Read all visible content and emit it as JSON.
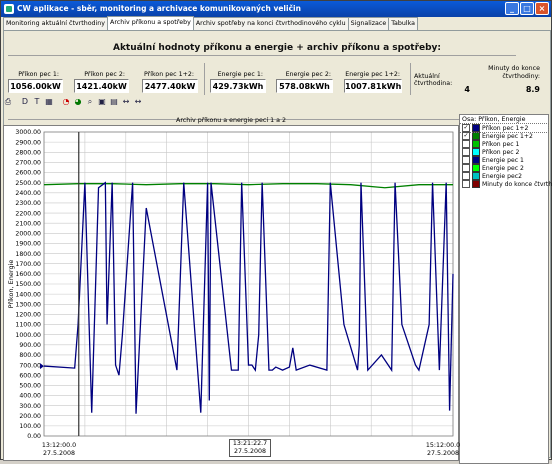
{
  "window": {
    "title": "CW aplikace  - sběr, monitoring a archivace komunikovaných veličin"
  },
  "tabs": [
    {
      "label": "Monitoring aktuální čtvrthodiny",
      "active": false
    },
    {
      "label": "Archiv příkonu a spotřeby",
      "active": true
    },
    {
      "label": "Archiv spotřeby na konci čtvrthodinového cyklu",
      "active": false
    },
    {
      "label": "Signalizace",
      "active": false
    },
    {
      "label": "Tabulka",
      "active": false
    }
  ],
  "heading": "Aktuální hodnoty příkonu a energie + archiv příkonu a spotřeby:",
  "readouts": {
    "prikon1": {
      "label": "Příkon pec 1:",
      "value": "1056.00kW"
    },
    "prikon2": {
      "label": "Příkon pec 2:",
      "value": "1421.40kW"
    },
    "prikon12": {
      "label": "Příkon pec 1+2:",
      "value": "2477.40kW"
    },
    "energie1": {
      "label": "Energie pec 1:",
      "value": "429.73kWh"
    },
    "energie2": {
      "label": "Energie pec 2:",
      "value": "578.08kWh"
    },
    "energie12": {
      "label": "Energie pec 1+2:",
      "value": "1007.81kWh"
    },
    "ctvrthodina": {
      "label": "Aktuální čtvrthodina:",
      "value": "4"
    },
    "minuty": {
      "label": "Minuty do konce čtvrthodiny:",
      "value": "8.9"
    }
  },
  "toolbar_icons": [
    "printer-icon",
    "axis-dt-icon",
    "axis-y-icon",
    "grid-icon",
    "zoom-in-icon",
    "zoom-out-icon",
    "zoom-icon",
    "pan-icon",
    "pan-back-icon",
    "arrows-h-icon",
    "arrows-h2-icon"
  ],
  "toolbar_text": {
    "d": "D",
    "t": "T",
    "arrows1": "↔",
    "arrows2": "↔"
  },
  "legend": {
    "title": "Osa: Příkon, Energie",
    "items": [
      {
        "label": "Příkon pec 1+2",
        "checked": true,
        "color": "#000080",
        "selected": true
      },
      {
        "label": "Energie pec 1+2",
        "checked": true,
        "color": "#008000"
      },
      {
        "label": "Příkon pec 1",
        "checked": false,
        "color": "#00c000"
      },
      {
        "label": "Příkon pec 2",
        "checked": false,
        "color": "#00ffff"
      },
      {
        "label": "Energie pec 1",
        "checked": false,
        "color": "#000080"
      },
      {
        "label": "Energie pec 2",
        "checked": false,
        "color": "#00ff00"
      },
      {
        "label": "Energie pec2",
        "checked": false,
        "color": "#00c0c0"
      },
      {
        "label": "Minuty do konce čtvrthodiny",
        "checked": false,
        "color": "#800000"
      }
    ]
  },
  "chart_data": {
    "type": "line",
    "title": "Archiv příkonu a energie pecí 1 a 2",
    "ylabel": "Příkon, Energie",
    "xlabel": "",
    "ylim": [
      0,
      3000
    ],
    "ytick_step": 100,
    "grid": true,
    "legend_position": "right",
    "x_labels": [
      {
        "time": "13:12:00.0",
        "date": "27.5.2008"
      },
      {
        "time": "13:21:22.7",
        "date": "27.5.2008"
      },
      {
        "time": "15:12:00.0",
        "date": "27.5.2008"
      }
    ],
    "cursor": {
      "time": "13:21:22.7",
      "date": "27.5.2008"
    },
    "series": [
      {
        "name": "Energie pec 1+2",
        "color": "#008000",
        "x": [
          0,
          10,
          20,
          30,
          40,
          50,
          60,
          70,
          80,
          90,
          100,
          110,
          120
        ],
        "y": [
          2480,
          2490,
          2490,
          2480,
          2490,
          2490,
          2480,
          2490,
          2490,
          2480,
          2450,
          2480,
          2480
        ]
      },
      {
        "name": "Příkon pec 1+2",
        "color": "#000080",
        "x": [
          0,
          9,
          10,
          12,
          14,
          16,
          18,
          18.5,
          20,
          21,
          22,
          23,
          26,
          27,
          30,
          39,
          41,
          46,
          48,
          48.5,
          49,
          55,
          57,
          58,
          60,
          61,
          62,
          63,
          64,
          66,
          67,
          68,
          70,
          72,
          73,
          74,
          78,
          83,
          84,
          88,
          92,
          92.5,
          93,
          95,
          99,
          102,
          103,
          105,
          108,
          109,
          110,
          113,
          114,
          116,
          118,
          119,
          120
        ],
        "y": [
          690,
          670,
          1100,
          2500,
          230,
          2450,
          2500,
          1100,
          2500,
          700,
          600,
          1000,
          2500,
          220,
          2250,
          650,
          2500,
          230,
          2500,
          350,
          2500,
          650,
          650,
          2500,
          700,
          700,
          650,
          1000,
          2500,
          650,
          650,
          680,
          650,
          680,
          870,
          650,
          700,
          650,
          2500,
          1100,
          650,
          900,
          2500,
          650,
          800,
          650,
          2500,
          1100,
          800,
          700,
          650,
          1100,
          2500,
          650,
          2500,
          250,
          1600
        ]
      }
    ]
  }
}
